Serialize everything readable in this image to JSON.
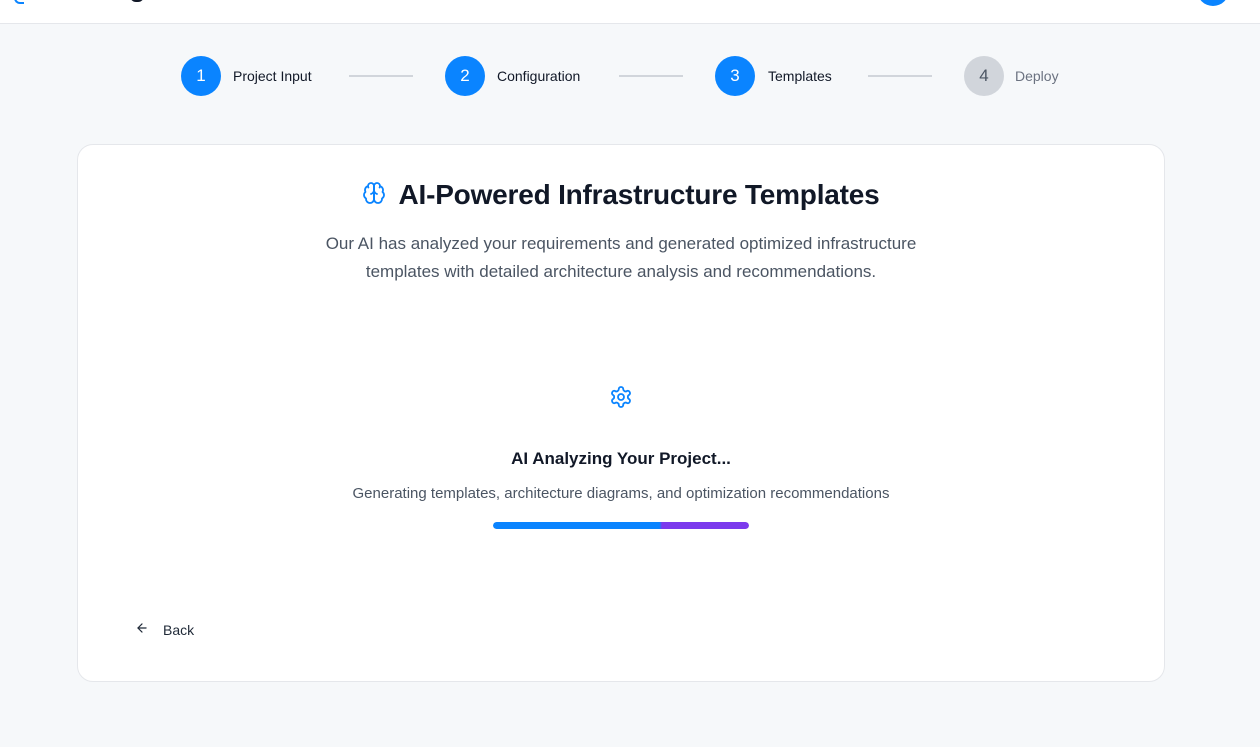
{
  "steps": [
    {
      "number": "1",
      "label": "Project Input",
      "state": "completed"
    },
    {
      "number": "2",
      "label": "Configuration",
      "state": "completed"
    },
    {
      "number": "3",
      "label": "Templates",
      "state": "active"
    },
    {
      "number": "4",
      "label": "Deploy",
      "state": "pending"
    }
  ],
  "header": {
    "title": "AI-Powered Infrastructure Templates",
    "title_icon": "brain-icon",
    "subtitle_line1": "Our AI has analyzed your requirements and generated optimized infrastructure",
    "subtitle_line2": "templates with detailed architecture analysis and recommendations."
  },
  "status": {
    "icon": "gear-icon",
    "title": "AI Analyzing Your Project...",
    "description": "Generating templates, architecture diagrams, and optimization recommendations",
    "progress_percent": 100
  },
  "footer": {
    "back_label": "Back",
    "back_icon": "arrow-left-icon"
  },
  "colors": {
    "accent": "#0a84ff",
    "accent_secondary": "#7c3aed",
    "inactive": "#d1d5db"
  }
}
